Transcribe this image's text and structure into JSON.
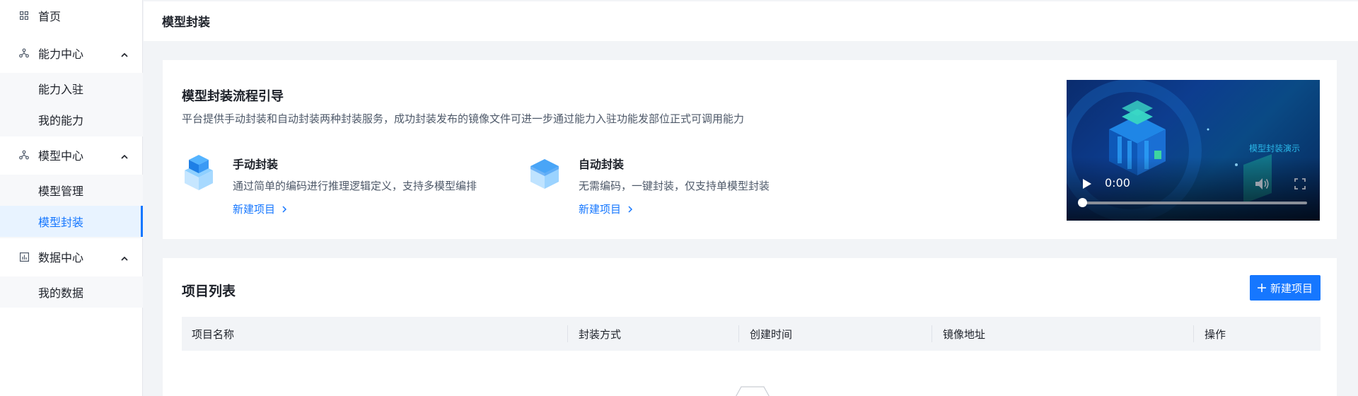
{
  "sidebar": {
    "home": {
      "label": "首页",
      "icon": "grid-icon"
    },
    "capability": {
      "label": "能力中心",
      "icon": "nodes-icon",
      "children": [
        "能力入驻",
        "我的能力"
      ]
    },
    "model": {
      "label": "模型中心",
      "icon": "nodes-icon",
      "children": [
        "模型管理",
        "模型封装"
      ]
    },
    "data": {
      "label": "数据中心",
      "icon": "chart-icon",
      "children": [
        "我的数据"
      ]
    },
    "active_item": "模型封装"
  },
  "header": {
    "title": "模型封装"
  },
  "guide": {
    "title": "模型封装流程引导",
    "description": "平台提供手动封装和自动封装两种封装服务，成功封装发布的镜像文件可进一步通过能力入驻功能发部位正式可调用能力",
    "modes": [
      {
        "title": "手动封装",
        "description": "通过简单的编码进行推理逻辑定义，支持多模型编排",
        "link": "新建项目"
      },
      {
        "title": "自动封装",
        "description": "无需编码，一键封装，仅支持单模型封装",
        "link": "新建项目"
      }
    ],
    "video": {
      "caption": "模型封装演示",
      "time": "0:00",
      "progress": 0
    }
  },
  "project_list": {
    "title": "项目列表",
    "new_button": "新建项目",
    "columns": [
      "项目名称",
      "封装方式",
      "创建时间",
      "镜像地址",
      "操作"
    ]
  },
  "colors": {
    "accent": "#1677ff",
    "active_bg": "#e8f3ff",
    "page_bg": "#f2f4f7"
  }
}
